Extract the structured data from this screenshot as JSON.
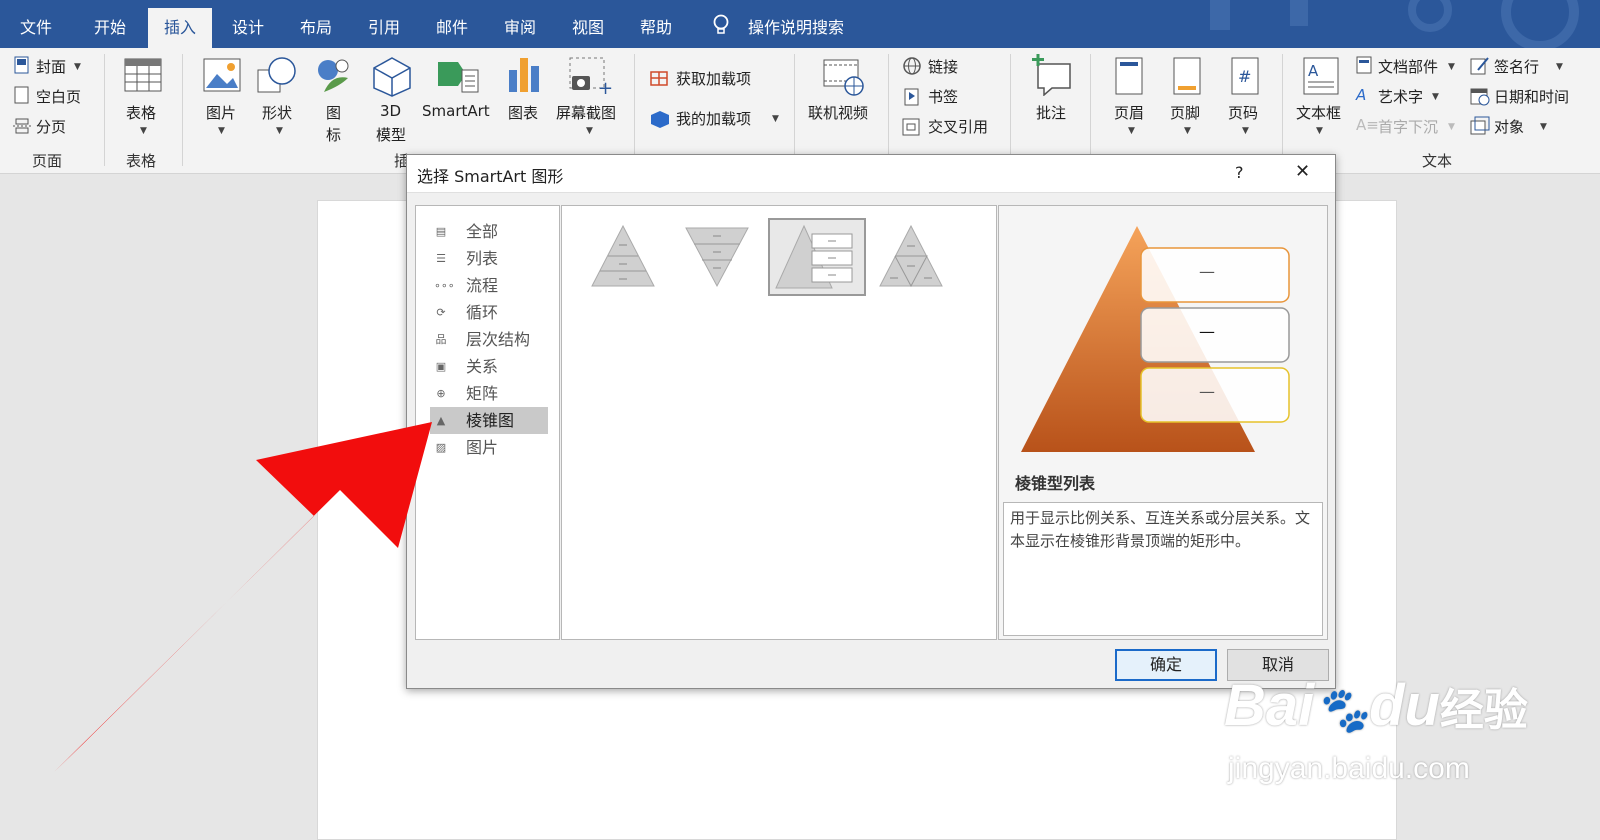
{
  "tabs": [
    {
      "label": "文件"
    },
    {
      "label": "开始"
    },
    {
      "label": "插入"
    },
    {
      "label": "设计"
    },
    {
      "label": "布局"
    },
    {
      "label": "引用"
    },
    {
      "label": "邮件"
    },
    {
      "label": "审阅"
    },
    {
      "label": "视图"
    },
    {
      "label": "帮助"
    }
  ],
  "tell_me": "操作说明搜索",
  "ribbon": {
    "pages": {
      "cover": "封面",
      "blank": "空白页",
      "break": "分页",
      "group": "页面"
    },
    "tables": {
      "table": "表格",
      "group": "表格"
    },
    "illustrations": {
      "picture": "图片",
      "shapes": "形状",
      "icons_1": "图",
      "icons_2": "标",
      "model_1": "3D",
      "model_2": "模型",
      "smartart": "SmartArt",
      "chart": "图表",
      "screenshot": "屏幕截图",
      "group_partial": "插"
    },
    "addins": {
      "get": "获取加载项",
      "my": "我的加载项"
    },
    "media": {
      "video": "联机视频"
    },
    "links": {
      "link": "链接",
      "bookmark": "书签",
      "crossref": "交叉引用"
    },
    "comments": {
      "comment": "批注"
    },
    "header_footer": {
      "header": "页眉",
      "footer": "页脚",
      "page_number": "页码"
    },
    "text": {
      "textbox": "文本框",
      "quickparts": "文档部件",
      "wordart": "艺术字",
      "dropcap": "首字下沉",
      "signature": "签名行",
      "datetime": "日期和时间",
      "object": "对象",
      "group": "文本"
    }
  },
  "dialog": {
    "title": "选择 SmartArt 图形",
    "help": "?",
    "close": "✕",
    "categories": [
      {
        "label": "全部",
        "icon": "all-icon"
      },
      {
        "label": "列表",
        "icon": "list-icon"
      },
      {
        "label": "流程",
        "icon": "process-icon"
      },
      {
        "label": "循环",
        "icon": "cycle-icon"
      },
      {
        "label": "层次结构",
        "icon": "hierarchy-icon"
      },
      {
        "label": "关系",
        "icon": "relationship-icon"
      },
      {
        "label": "矩阵",
        "icon": "matrix-icon"
      },
      {
        "label": "棱锥图",
        "icon": "pyramid-icon",
        "selected": true
      },
      {
        "label": "图片",
        "icon": "picture-icon"
      }
    ],
    "preview": {
      "dash_1": "—",
      "dash_2": "—",
      "dash_3": "—",
      "name": "棱锥型列表",
      "description": "用于显示比例关系、互连关系或分层关系。文本显示在棱锥形背景顶端的矩形中。"
    },
    "ok": "确定",
    "cancel": "取消"
  },
  "watermark": {
    "brand": "Bai",
    "brand2": "du",
    "brand_cn": "经验",
    "url": "jingyan.baidu.com"
  },
  "colors": {
    "ribbon_blue": "#2b579a",
    "arrow_red": "#f20d0d",
    "pyramid_orange": "#e0782f"
  }
}
